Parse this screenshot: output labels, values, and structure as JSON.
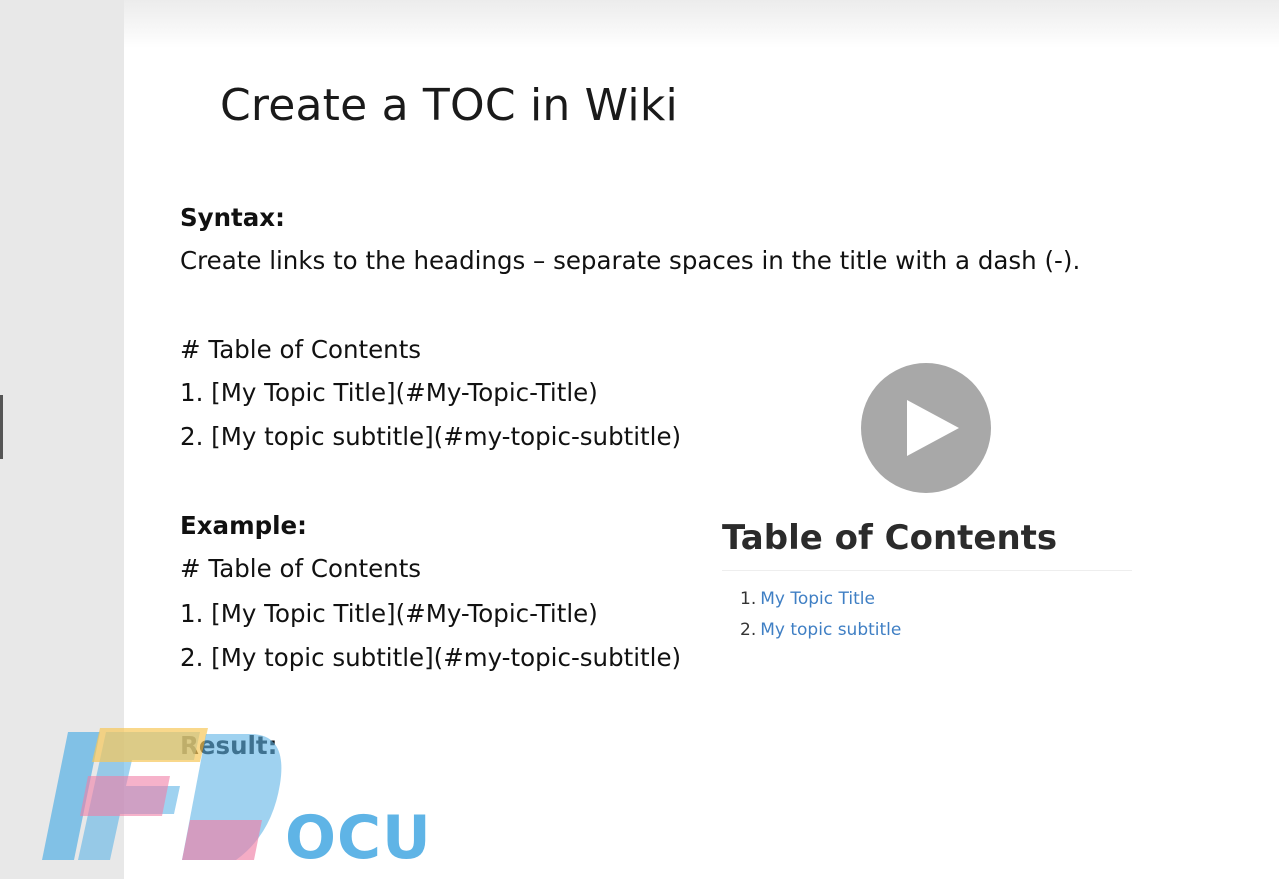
{
  "slide": {
    "title": "Create a TOC in Wiki",
    "syntax_heading": "Syntax:",
    "syntax_text": "Create links to the headings – separate spaces in the title with a dash (-).",
    "syntax_lines": [
      "# Table of Contents",
      "1. [My Topic Title](#My-Topic-Title)",
      "2. [My topic subtitle](#my-topic-subtitle)"
    ],
    "example_heading": "Example:",
    "example_lines": [
      "# Table of Contents",
      "1. [My Topic Title](#My-Topic-Title)",
      "2. [My topic subtitle](#my-topic-subtitle)"
    ],
    "result_heading": "Result:"
  },
  "toc_preview": {
    "title": "Table of Contents",
    "items": [
      {
        "number": "1.",
        "label": "My Topic Title"
      },
      {
        "number": "2.",
        "label": "My topic subtitle"
      }
    ]
  },
  "video": {
    "play_icon": "play-icon"
  },
  "watermark": {
    "text": "OCU"
  },
  "colors": {
    "link": "#3f7fc4",
    "play_button": "#a8a8a8",
    "left_strip": "#e8e8e8",
    "watermark_blue": "#5fb4e6",
    "watermark_pink": "#f07fa6",
    "watermark_yellow": "#f7c85a"
  }
}
